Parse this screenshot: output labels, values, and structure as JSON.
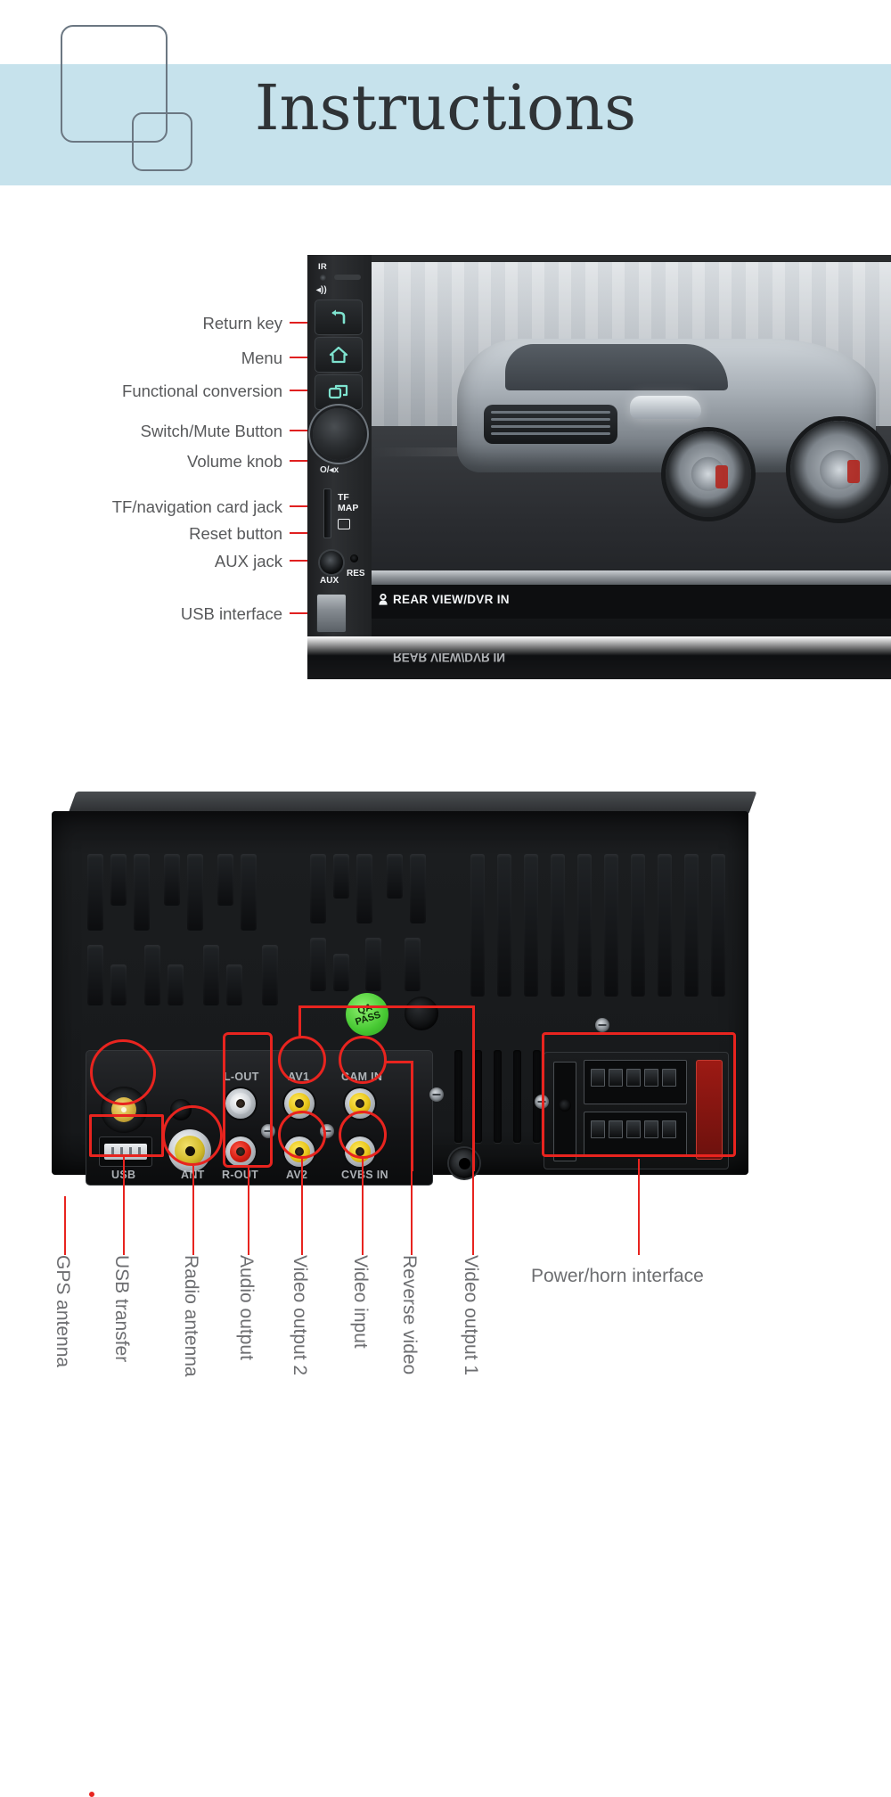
{
  "banner": {
    "title": "Instructions",
    "background_color": "#c6e2ec",
    "shape_outline_color": "#6b7782"
  },
  "front_panel": {
    "callouts": [
      {
        "label": "Return key"
      },
      {
        "label": "Menu"
      },
      {
        "label": "Functional conversion"
      },
      {
        "label": "Switch/Mute Button"
      },
      {
        "label": "Volume knob"
      },
      {
        "label": "TF/navigation card jack"
      },
      {
        "label": "Reset button"
      },
      {
        "label": "AUX jack"
      },
      {
        "label": "USB interface"
      }
    ],
    "device_markings": {
      "ir": "IR",
      "mute_glyph": "◂))",
      "return_glyph": "↩",
      "menu_glyph": "⌂",
      "switch_glyph": "❐",
      "knob_label": "O/◂x",
      "tf": "TF",
      "map": "MAP",
      "aux": "AUX",
      "res": "RES",
      "screen_bottom_text": "REAR VIEW/DVR IN",
      "screen_bottom_text_reflection": "REAR VIEW/DVR IN"
    }
  },
  "rear_panel": {
    "qa_sticker": {
      "line1": "QA",
      "line2": "PASS",
      "color": "#46c832"
    },
    "port_markings": [
      {
        "label": "L-OUT"
      },
      {
        "label": "AV1"
      },
      {
        "label": "CAM IN"
      },
      {
        "label": "USB"
      },
      {
        "label": "ANT"
      },
      {
        "label": "R-OUT"
      },
      {
        "label": "AV2"
      },
      {
        "label": "CVBS IN"
      }
    ],
    "callouts": [
      {
        "label": "GPS antenna",
        "orientation": "vertical"
      },
      {
        "label": "USB transfer",
        "orientation": "vertical"
      },
      {
        "label": "Radio antenna",
        "orientation": "vertical"
      },
      {
        "label": "Audio output",
        "orientation": "vertical"
      },
      {
        "label": "Video output 2",
        "orientation": "vertical"
      },
      {
        "label": "Video input",
        "orientation": "vertical"
      },
      {
        "label": "Reverse video",
        "orientation": "vertical"
      },
      {
        "label": "Video output 1",
        "orientation": "vertical"
      },
      {
        "label": "Power/horn interface",
        "orientation": "horizontal"
      }
    ]
  },
  "colors": {
    "highlight_red": "#e8241f",
    "label_gray": "#6d6e71",
    "banner_blue": "#c6e2ec"
  }
}
